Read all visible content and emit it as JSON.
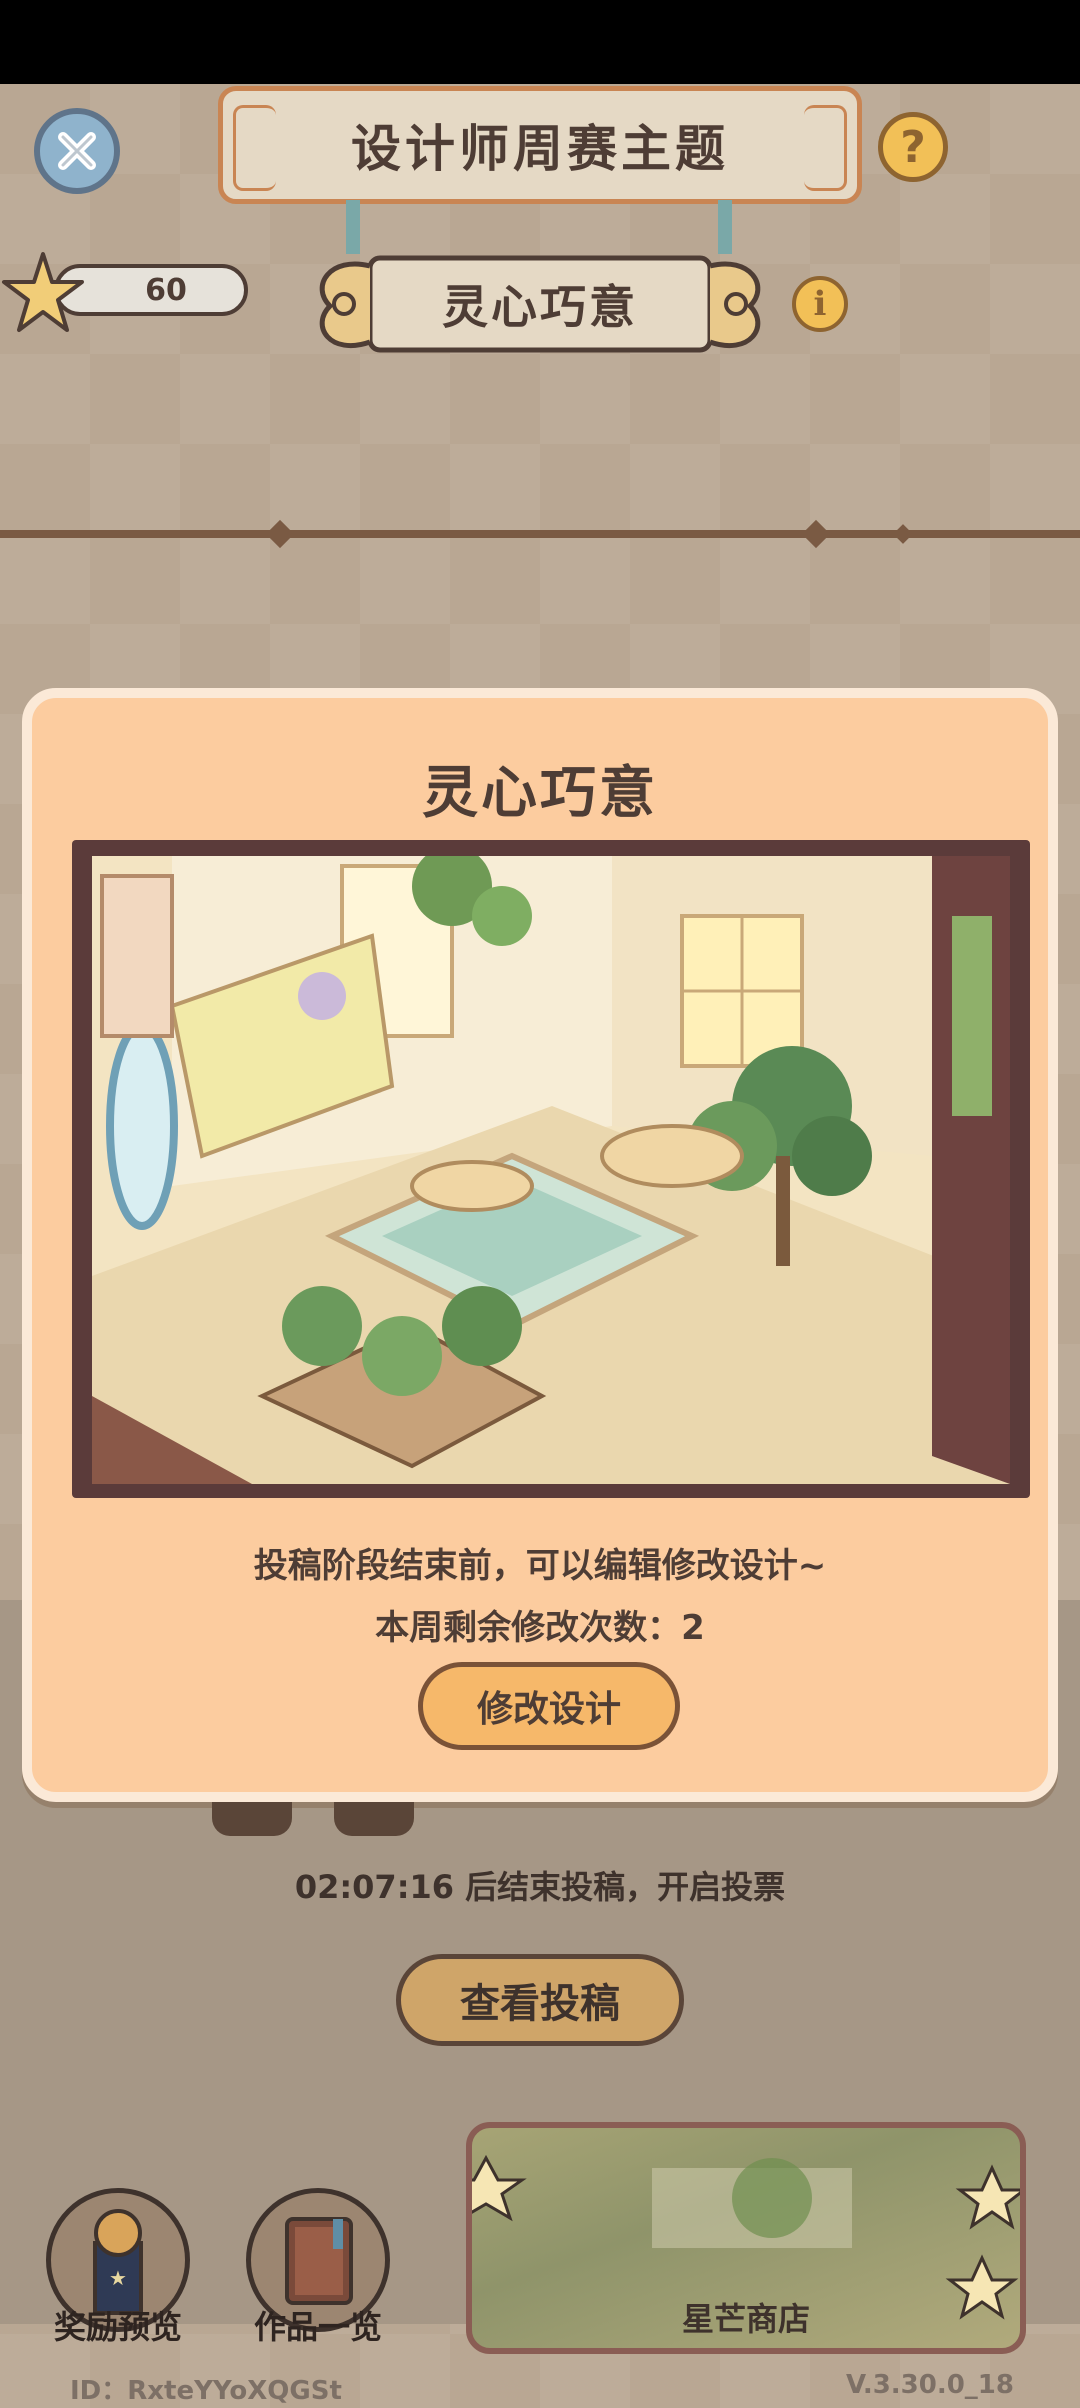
{
  "header": {
    "title": "设计师周赛主题",
    "theme_name": "灵心巧意",
    "star_count": "60",
    "help_symbol": "?",
    "info_symbol": "i",
    "icons": [
      "close-icon",
      "help-icon",
      "info-icon",
      "star-icon"
    ]
  },
  "modal": {
    "title": "灵心巧意",
    "note": "投稿阶段结束前，可以编辑修改设计~",
    "remaining_label": "本周剩余修改次数：2",
    "modify_button": "修改设计"
  },
  "event": {
    "countdown": "02:07:16  后结束投稿，开启投票",
    "view_button": "查看投稿"
  },
  "bottom": {
    "reward_label": "奖励预览",
    "works_label": "作品一览",
    "shop_label": "星芒商店",
    "id_text": "ID：RxteYYoXQGSt",
    "version": "V.3.30.0_18"
  },
  "colors": {
    "modal_bg": "#fccc9f",
    "modal_border": "#fbe9d7",
    "text_dark": "#4e3d35",
    "button_orange": "#f6b86a",
    "frame_brown": "#5b3b3a"
  }
}
